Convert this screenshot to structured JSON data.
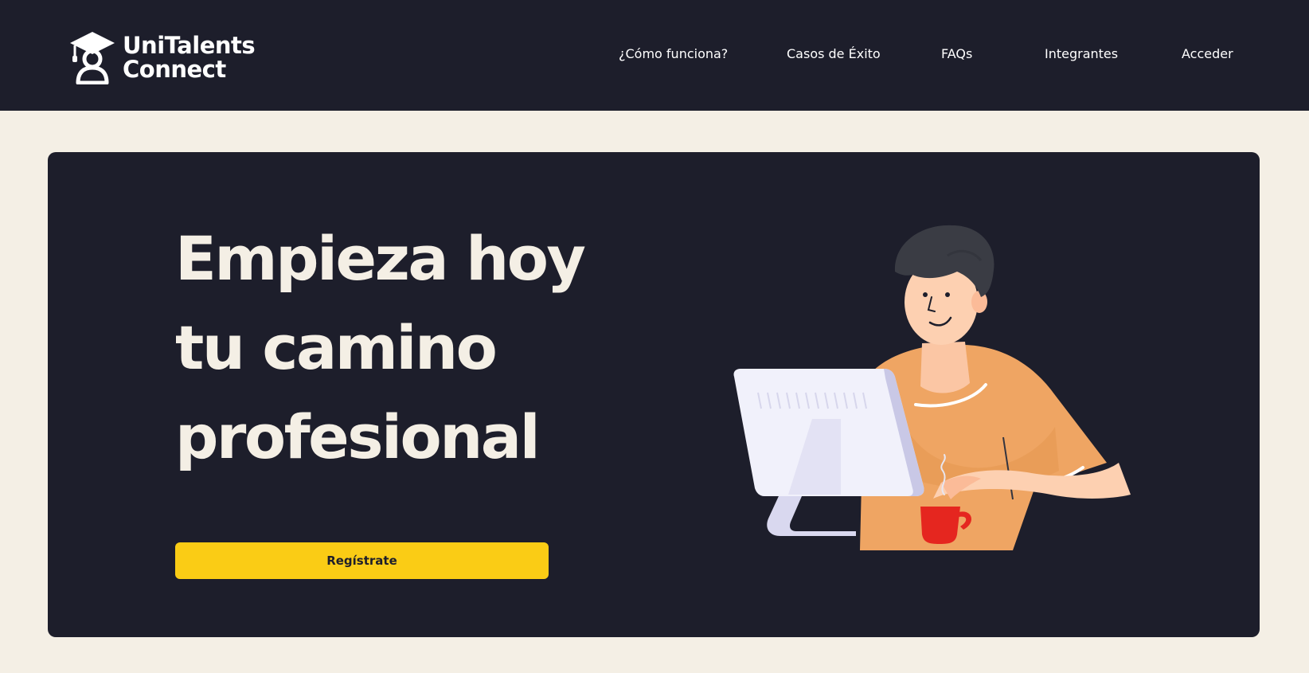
{
  "header": {
    "logo": {
      "line1": "UniTalents",
      "line2": "Connect",
      "icon": "graduate-student-icon"
    },
    "nav": [
      {
        "label": "¿Cómo funciona?"
      },
      {
        "label": "Casos de Éxito"
      },
      {
        "label": "FAQs"
      },
      {
        "label": "Integrantes"
      },
      {
        "label": "Acceder"
      }
    ]
  },
  "hero": {
    "title_lines": [
      "Empieza hoy",
      "tu camino",
      "profesional"
    ],
    "cta_label": "Regístrate",
    "illustration": "person-at-computer-with-coffee"
  },
  "colors": {
    "navbar_bg": "#1D1E2B",
    "page_bg": "#F4EFE5",
    "hero_bg": "#1D1E2B",
    "hero_text": "#F4EFE5",
    "cta_bg": "#FACC15",
    "shirt": "#EFA563",
    "cup": "#E5261F"
  }
}
